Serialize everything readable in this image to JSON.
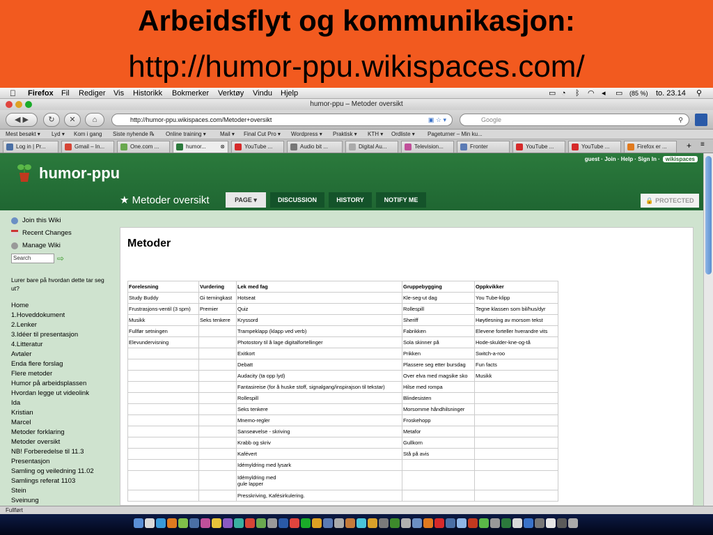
{
  "slide": {
    "title": "Arbeidsflyt og kommunikasjon:",
    "url": "http://humor-ppu.wikispaces.com/"
  },
  "menubar": {
    "app": "Firefox",
    "items": [
      "Fil",
      "Rediger",
      "Vis",
      "Historikk",
      "Bokmerker",
      "Verktøy",
      "Vindu",
      "Hjelp"
    ],
    "battery": "(85 %)",
    "clock": "to. 23.14"
  },
  "window": {
    "title": "humor-ppu – Metoder oversikt"
  },
  "navbar": {
    "url": "http://humor-ppu.wikispaces.com/Metoder+oversikt",
    "search_placeholder": "Google"
  },
  "bookmarks": [
    "Mest besøkt ▾",
    "Lyd ▾",
    "Kom i gang",
    "Siste nyhende ℞",
    "Online training ▾",
    "Mail ▾",
    "Final Cut Pro ▾",
    "Wordpress ▾",
    "Praktisk ▾",
    "KTH ▾",
    "Ordliste ▾",
    "Pageturner – Min ku..."
  ],
  "tabs": [
    {
      "label": "Log in | Pr...",
      "color": "#4a6fa5"
    },
    {
      "label": "Gmail – In...",
      "color": "#d64536"
    },
    {
      "label": "One.com ...",
      "color": "#6aa84f"
    },
    {
      "label": "humor...",
      "color": "#2b7a3c"
    },
    {
      "label": "YouTube ...",
      "color": "#d62a2a"
    },
    {
      "label": "Audio bit ...",
      "color": "#777777"
    },
    {
      "label": "Digital Au...",
      "color": "#aaaaaa"
    },
    {
      "label": "Television...",
      "color": "#c0509a"
    },
    {
      "label": "Fronter",
      "color": "#5b7bb5"
    },
    {
      "label": "YouTube ...",
      "color": "#d62a2a"
    },
    {
      "label": "YouTube ...",
      "color": "#d62a2a"
    },
    {
      "label": "Firefox er ...",
      "color": "#e07a1f"
    }
  ],
  "wiki": {
    "site_name": "humor-ppu",
    "toplinks": "guest · Join · Help · Sign In ·",
    "badge": "wikispaces",
    "page_name": "★ Metoder oversikt",
    "tabs": [
      "PAGE ▾",
      "DISCUSSION",
      "HISTORY",
      "NOTIFY ME"
    ],
    "protected": "PROTECTED"
  },
  "sidebar": {
    "tools": [
      "Join this Wiki",
      "Recent Changes",
      "Manage Wiki"
    ],
    "search_value": "Search",
    "note": "Lurer bare på hvordan dette tar seg ut?",
    "links": [
      "Home",
      "1.Hoveddokument",
      "2.Lenker",
      "3.Idéer til presentasjon",
      "4.Litteratur",
      "Avtaler",
      "Enda flere forslag",
      "Flere metoder",
      "Humor på arbeidsplassen",
      "Hvordan legge ut videolink",
      "Ida",
      "Kristian",
      "Marcel",
      "Metoder forklaring",
      "Metoder oversikt",
      "NB! Forberedelse til 11.3",
      "Presentasjon",
      "Samling og veiledning 11.02",
      "Samlings referat 1103",
      "Stein",
      "Sveinung"
    ]
  },
  "main": {
    "title": "Metoder",
    "table": {
      "headers": [
        "Forelesning",
        "Vurdering",
        "Lek med fag",
        "Gruppebygging",
        "Oppkvikker"
      ],
      "rows": [
        [
          "Study Buddy",
          "Gi terningkast",
          "Hotseat",
          "Kle-seg-ut dag",
          "You Tube-klipp"
        ],
        [
          "Frustrasjons-ventil (3 spm)",
          "Premier",
          "Quiz",
          "Rollespill",
          "Tegne klassen som bil/hus/dyr"
        ],
        [
          "Musikk",
          "Seks tenkere",
          "Kryssord",
          "Sheriff",
          "Høytlesning av morsom tekst"
        ],
        [
          "Fullfør setningen",
          "",
          "Trampeklapp (klapp ved verb)",
          "Fabrikken",
          "Elevene forteller hverandre vits"
        ],
        [
          "Elevundervisning",
          "",
          "Photostory til å lage digitalfortellinger",
          "Sola skinner på",
          "Hode-skulder-kne-og-tå"
        ],
        [
          "",
          "",
          "Exitkort",
          "Prikken",
          "Switch-a-roo"
        ],
        [
          "",
          "",
          "Debatt",
          "Plassere seg etter bursdag",
          "Fun facts"
        ],
        [
          "",
          "",
          "Audacity (ta opp lyd)",
          "Over elva med magsike sko",
          "Musikk"
        ],
        [
          "",
          "",
          "Fantasireise (for å huske stoff, signalgang/inspirajson til tekstar)",
          "Hilse med rompa",
          ""
        ],
        [
          "",
          "",
          "Rollespill",
          "Blindesisten",
          ""
        ],
        [
          "",
          "",
          "Seks tenkere",
          "Morsomme håndhilsninger",
          ""
        ],
        [
          "",
          "",
          "Mnemo-regler",
          "Froskehopp",
          ""
        ],
        [
          "",
          "",
          "Sanseøvelse - skriving",
          "Metafor",
          ""
        ],
        [
          "",
          "",
          "Krabb og skriv",
          "Gullkorn",
          ""
        ],
        [
          "",
          "",
          "Kafévert",
          "Stå på avis",
          ""
        ],
        [
          "",
          "",
          "Idémyldring med lysark",
          "",
          ""
        ],
        [
          "",
          "",
          "Idémyldring med\ngule lapper",
          "",
          ""
        ],
        [
          "",
          "",
          "Presskriving, Kafésirkulering.",
          "",
          ""
        ]
      ]
    }
  },
  "status": "Fullført"
}
